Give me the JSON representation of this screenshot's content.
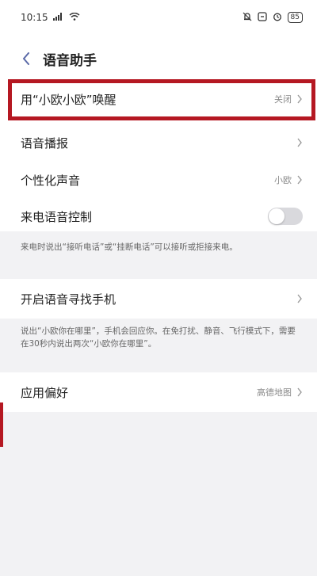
{
  "status_bar": {
    "time": "10:15",
    "battery": "85"
  },
  "header": {
    "title": "语音助手"
  },
  "rows": {
    "wake": {
      "label": "用“小欧小欧”唤醒",
      "value": "关闭"
    },
    "broadcast": {
      "label": "语音播报"
    },
    "voice": {
      "label": "个性化声音",
      "value": "小欧"
    },
    "call_control": {
      "label": "来电语音控制",
      "toggle_on": false
    },
    "find_phone": {
      "label": "开启语音寻找手机"
    },
    "app_pref": {
      "label": "应用偏好",
      "value": "高德地图"
    }
  },
  "notes": {
    "call_control": "来电时说出“接听电话”或“挂断电话”可以接听或拒接来电。",
    "find_phone": "说出“小欧你在哪里”，手机会回应你。在免打扰、静音、飞行模式下，需要在30秒内说出两次“小欧你在哪里”。"
  },
  "icons": {
    "back": "chevron-left-icon",
    "chevron": "chevron-right-icon",
    "wifi": "wifi-icon",
    "alarm": "alarm-icon",
    "bell": "bell-icon"
  },
  "colors": {
    "accent": "#5b6aa8",
    "highlight": "#b51822"
  }
}
